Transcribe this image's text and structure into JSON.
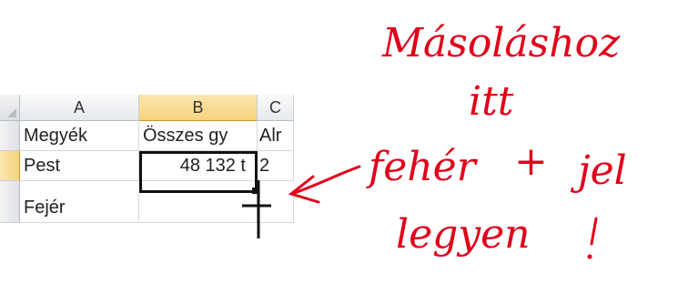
{
  "sheet": {
    "columns": [
      "A",
      "B",
      "C"
    ],
    "selected_column": "B",
    "rows": [
      {
        "cells": [
          "Megyék",
          "Összes gy",
          "Alr"
        ],
        "selected": false
      },
      {
        "cells": [
          "Pest",
          "48 132 t",
          "2"
        ],
        "selected": true
      },
      {
        "cells": [
          "Fejér",
          "",
          ""
        ],
        "selected": false
      }
    ],
    "active_cell": "B2"
  },
  "annotation": {
    "color": "#e0001a",
    "lines": [
      "Másoláshoz",
      "itt",
      "fehér",
      "+",
      "jel",
      "legyen",
      "!"
    ]
  },
  "colors": {
    "accent_selected": "#f6d37c",
    "annotation_red": "#e0001a"
  }
}
